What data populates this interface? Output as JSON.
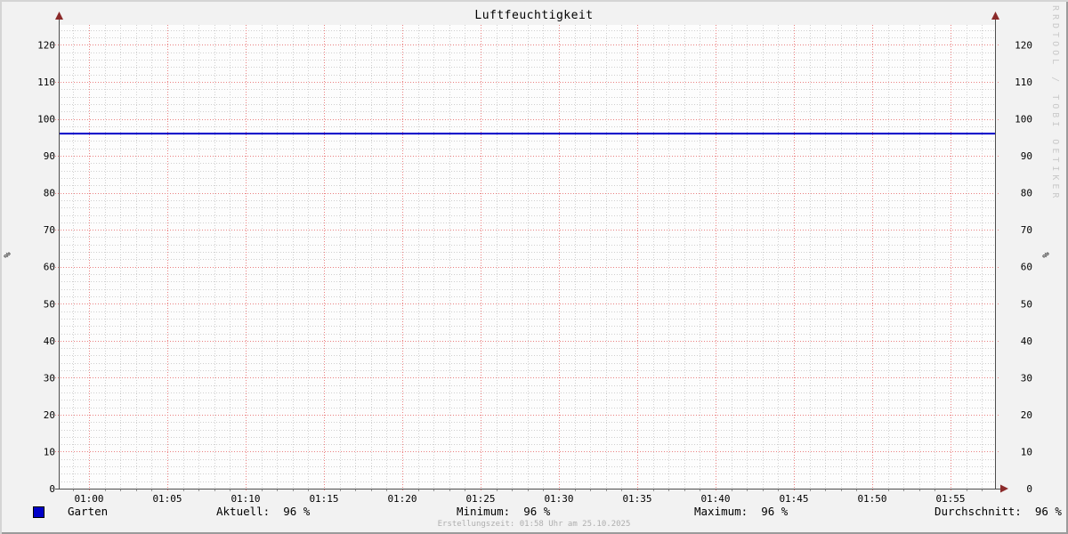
{
  "title": "Luftfeuchtigkeit",
  "watermark": "RRDTOOL / TOBI OETIKER",
  "footer": "Erstellungszeit: 01:58 Uhr am 25.10.2025",
  "vertical_label": "%",
  "legend": {
    "series_label": "Garten",
    "stats": [
      {
        "label": "Aktuell:",
        "value": "96 %"
      },
      {
        "label": "Minimum:",
        "value": "96 %"
      },
      {
        "label": "Maximum:",
        "value": "96 %"
      },
      {
        "label": "Durchschnitt:",
        "value": "96 %"
      }
    ]
  },
  "colors": {
    "series": "#0000c8",
    "grid_minor": "#cfcfcf",
    "grid_major": "#ea8080",
    "axis": "#4d4d4d",
    "arrow": "#8b2a2a",
    "background": "#f2f2f2",
    "canvas": "#fdfdfd",
    "watermark_text": "#c9c9c9",
    "footer_text": "#aeaeae"
  },
  "chart_data": {
    "type": "line",
    "title": "Luftfeuchtigkeit",
    "xlabel": "",
    "ylabel": "%",
    "ylim": [
      0,
      125.4
    ],
    "y_major_step": 10,
    "y_minor_step": 2,
    "y_tick_labels": [
      "0",
      "10",
      "20",
      "30",
      "40",
      "50",
      "60",
      "70",
      "80",
      "90",
      "100",
      "110",
      "120"
    ],
    "x_tick_labels": [
      "01:00",
      "01:05",
      "01:10",
      "01:15",
      "01:20",
      "01:25",
      "01:30",
      "01:35",
      "01:40",
      "01:45",
      "01:50",
      "01:55"
    ],
    "x_minor_divisions": 5,
    "grid": true,
    "legend_position": "bottom",
    "series": [
      {
        "name": "Garten",
        "color": "#0000c8",
        "constant_value": 96
      }
    ],
    "stats": {
      "aktuell": 96,
      "minimum": 96,
      "maximum": 96,
      "durchschnitt": 96,
      "unit": "%"
    }
  }
}
